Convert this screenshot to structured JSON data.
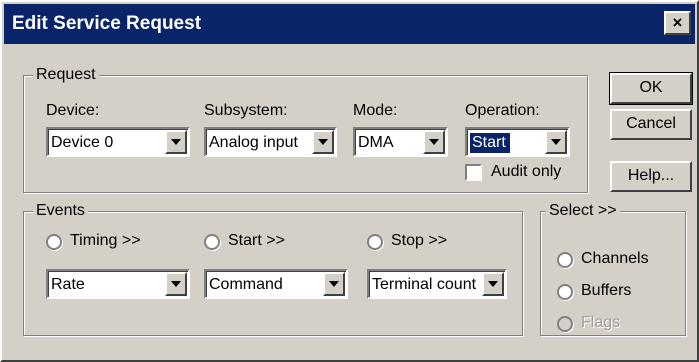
{
  "window": {
    "title": "Edit Service Request",
    "close_label": "×"
  },
  "request": {
    "legend": "Request",
    "device": {
      "label": "Device:",
      "value": "Device 0"
    },
    "subsystem": {
      "label": "Subsystem:",
      "value": "Analog input"
    },
    "mode": {
      "label": "Mode:",
      "value": "DMA"
    },
    "operation": {
      "label": "Operation:",
      "value": "Start"
    },
    "audit_only": {
      "label": "Audit only",
      "checked": false
    }
  },
  "buttons": {
    "ok": "OK",
    "cancel": "Cancel",
    "help": "Help..."
  },
  "events": {
    "legend": "Events",
    "timing": {
      "label": "Timing >>",
      "value": "Rate"
    },
    "start": {
      "label": "Start >>",
      "value": "Command"
    },
    "stop": {
      "label": "Stop >>",
      "value": "Terminal count"
    }
  },
  "select": {
    "legend": "Select >>",
    "channels": "Channels",
    "buffers": "Buffers",
    "flags": "Flags"
  },
  "colors": {
    "titlebar": "#0a246a",
    "face": "#d4d0c8",
    "selection": "#0a246a"
  }
}
